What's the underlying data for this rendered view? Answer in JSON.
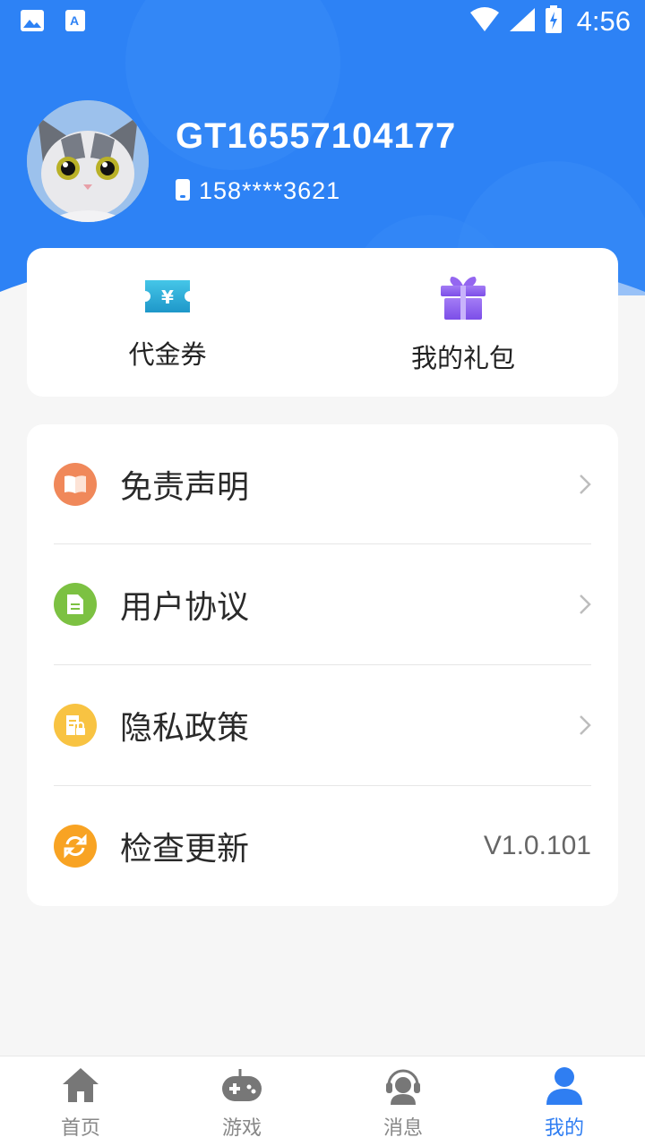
{
  "status_bar": {
    "time": "4:56"
  },
  "profile": {
    "username": "GT16557104177",
    "phone": "158****3621"
  },
  "quick_actions": [
    {
      "label": "代金券",
      "icon": "voucher-icon"
    },
    {
      "label": "我的礼包",
      "icon": "gift-icon"
    }
  ],
  "menu": {
    "items": [
      {
        "label": "免责声明",
        "icon": "book-icon",
        "color": "#f0885a"
      },
      {
        "label": "用户协议",
        "icon": "document-icon",
        "color": "#7cc142"
      },
      {
        "label": "隐私政策",
        "icon": "privacy-lock-icon",
        "color": "#f8c342"
      },
      {
        "label": "检查更新",
        "icon": "refresh-icon",
        "color": "#f8a323",
        "value": "V1.0.101"
      }
    ]
  },
  "bottom_nav": [
    {
      "label": "首页",
      "icon": "home-icon"
    },
    {
      "label": "游戏",
      "icon": "gamepad-icon"
    },
    {
      "label": "消息",
      "icon": "headset-icon"
    },
    {
      "label": "我的",
      "icon": "user-icon",
      "active": true
    }
  ],
  "colors": {
    "accent": "#2f7ef2",
    "header_blue": "#2d82f5"
  }
}
